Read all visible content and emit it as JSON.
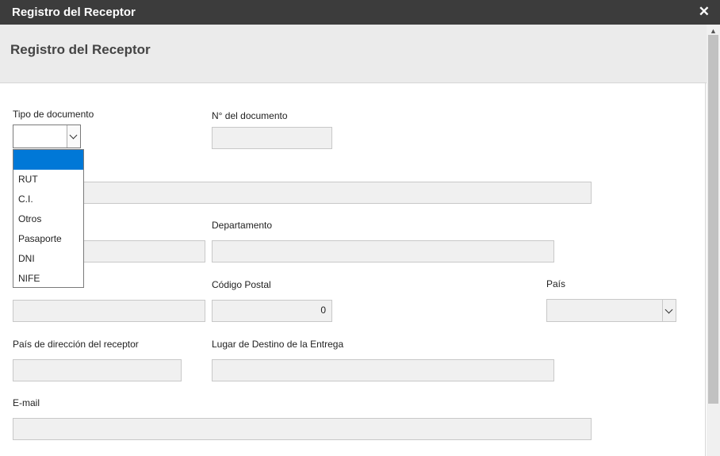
{
  "window": {
    "title": "Registro del Receptor",
    "close_glyph": "✕"
  },
  "header": {
    "heading": "Registro del Receptor"
  },
  "form": {
    "tipo_documento_label": "Tipo de documento",
    "tipo_documento_value": "",
    "tipo_documento_options": [
      "",
      "RUT",
      "C.I.",
      "Otros",
      "Pasaporte",
      "DNI",
      "NIFE"
    ],
    "nro_documento_label": "N° del documento",
    "departamento_label": "Departamento",
    "codigo_postal_label": "Código Postal",
    "codigo_postal_value": "0",
    "pais_label": "País",
    "pais_direccion_label": "País de dirección del receptor",
    "lugar_destino_label": "Lugar de Destino de la Entrega",
    "email_label": "E-mail"
  },
  "colors": {
    "titlebar": "#3c3c3c",
    "selected_option": "#0078d7",
    "field_bg": "#f0f0f0"
  }
}
